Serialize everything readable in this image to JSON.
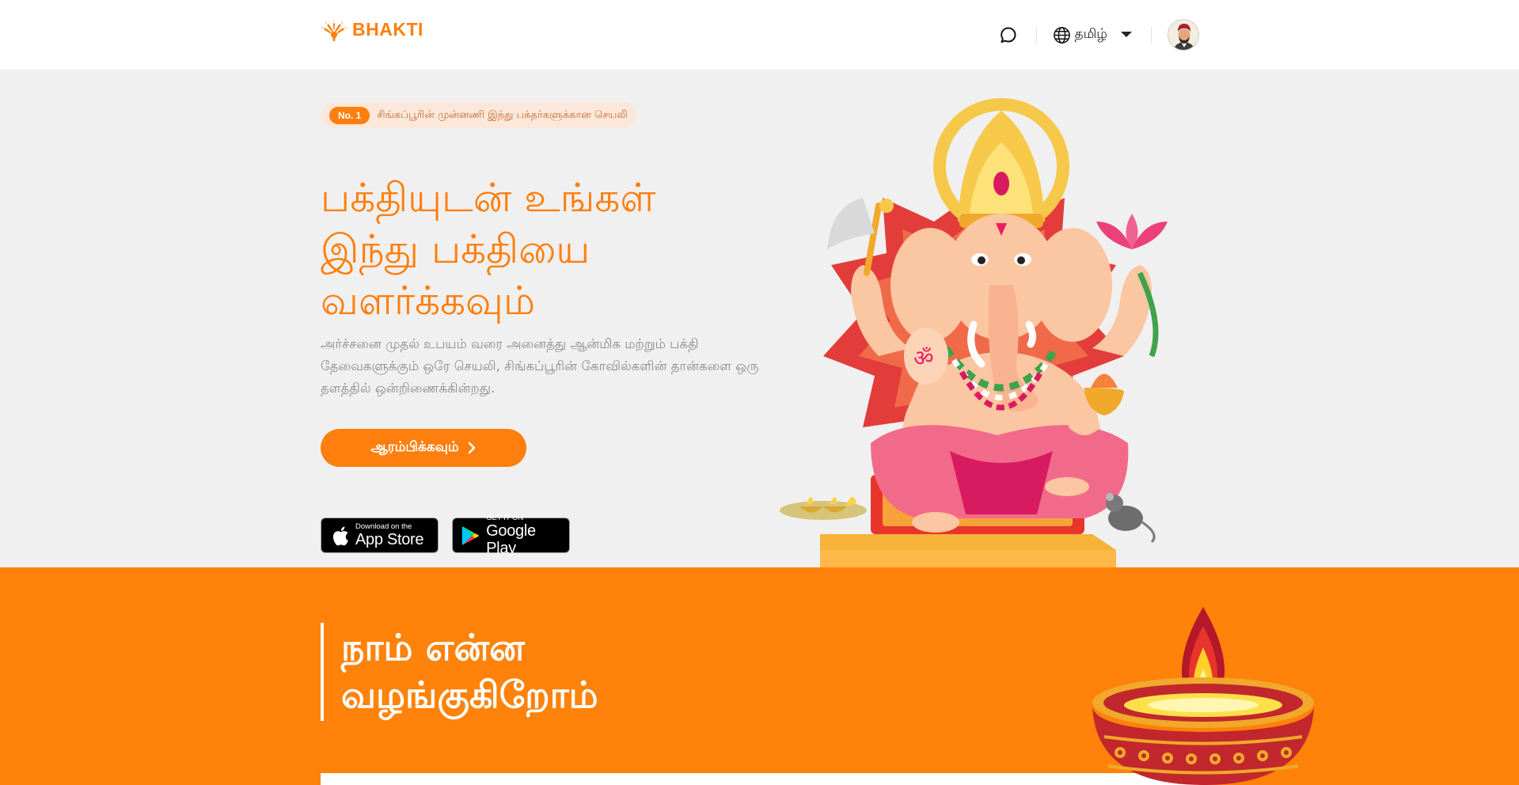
{
  "header": {
    "logo_text": "BHAKTI",
    "language_label": "தமிழ்",
    "icons": [
      "chat-icon",
      "globe-icon",
      "caret-down-icon"
    ]
  },
  "hero": {
    "badge_pill": "No. 1",
    "badge_text": "சிங்கப்பூரின் முன்னணி இந்து பக்தர்களுக்கான செயலி",
    "title_line1": "பக்தியுடன் உங்கள்",
    "title_line2": "இந்து பக்தியை",
    "title_line3": "வளர்க்கவும்",
    "description": "அர்ச்சனை முதல் உபயம் வரை அனைத்து ஆன்மிக மற்றும் பக்தி தேவைகளுக்கும் ஒரே செயலி, சிங்கப்பூரின் கோவில்களின் தான்களை ஒரு தளத்தில் ஒன்றிணைக்கின்றது.",
    "cta_label": "ஆரம்பிக்கவும்",
    "app_store_small": "Download on the",
    "app_store_big": "App Store",
    "google_play_small": "GET IT ON",
    "google_play_big": "Google Play"
  },
  "offer": {
    "title_line1": "நாம் என்ன",
    "title_line2": "வழங்குகிறோம்"
  },
  "colors": {
    "accent": "#ff7f0e",
    "badge_bg": "#fbe8db",
    "hero_bg": "#f0f0f0",
    "section_bg": "#ff820a"
  }
}
